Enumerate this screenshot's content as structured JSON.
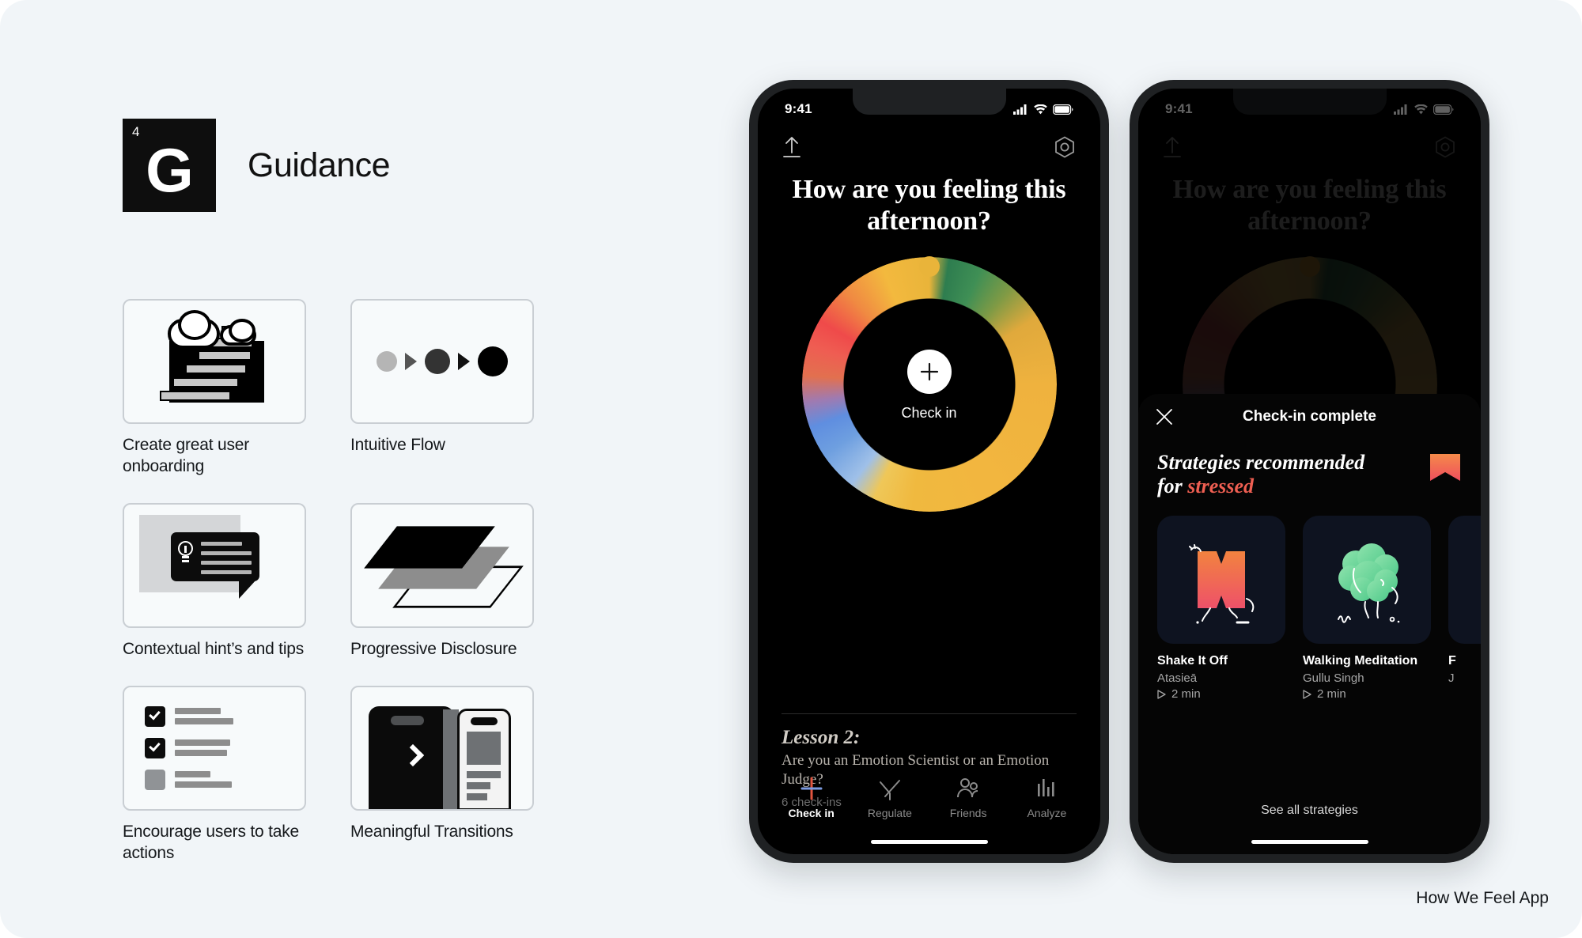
{
  "section": {
    "number": "4",
    "letter": "G",
    "title": "Guidance"
  },
  "principles": [
    {
      "label": "Create great user onboarding",
      "icon": "stairs-clouds-icon"
    },
    {
      "label": "Intuitive Flow",
      "icon": "flow-dots-icon"
    },
    {
      "label": "Contextual hint’s and tips",
      "icon": "hint-bubble-icon"
    },
    {
      "label": "Progressive Disclosure",
      "icon": "stacked-layers-icon"
    },
    {
      "label": "Encourage users to take actions",
      "icon": "checklist-icon"
    },
    {
      "label": "Meaningful Transitions",
      "icon": "screen-transition-icon"
    }
  ],
  "phone_left": {
    "status": {
      "time": "9:41",
      "cellular": "signal-icon",
      "wifi": "wifi-icon",
      "battery": "battery-icon"
    },
    "topbar": {
      "left_icon": "share-upload-icon",
      "right_icon": "hex-settings-icon"
    },
    "heading": "How are you feeling this afternoon?",
    "ring": {
      "plus_icon": "plus-icon",
      "check_in_label": "Check in",
      "cap_color": "#e9b43a",
      "colors": [
        "#e9b43a",
        "#2e7d4f",
        "#7f9a45",
        "#efb23e",
        "#9fc0e8",
        "#5f8ee0",
        "#ef4a4a",
        "#f08a42"
      ]
    },
    "lesson": {
      "title": "Lesson 2:",
      "subtitle": "Are you an Emotion Scientist or an Emotion Judge?",
      "meta": "6 check-ins"
    },
    "tabs": [
      {
        "label": "Check in",
        "icon": "plus-color-icon",
        "active": true
      },
      {
        "label": "Regulate",
        "icon": "breathing-icon",
        "active": false
      },
      {
        "label": "Friends",
        "icon": "friends-icon",
        "active": false
      },
      {
        "label": "Analyze",
        "icon": "bars-icon",
        "active": false
      }
    ]
  },
  "phone_right": {
    "status": {
      "time": "9:41",
      "cellular": "signal-icon",
      "wifi": "wifi-icon",
      "battery": "battery-icon"
    },
    "topbar": {
      "left_icon": "share-upload-icon",
      "right_icon": "hex-settings-icon"
    },
    "heading": "How are you feeling this afternoon?",
    "sheet": {
      "close_icon": "close-x-icon",
      "title": "Check-in complete",
      "headline_prefix": "Strategies recommended for ",
      "headline_emphasis": "stressed",
      "emphasis_color": "#ef5f52",
      "bookmark_icon": "bookmark-chevron-icon",
      "cards": [
        {
          "title": "Shake It Off",
          "author": "Atasieā",
          "duration": "2 min",
          "play_icon": "play-triangle-icon",
          "art": "orange-x-character"
        },
        {
          "title": "Walking Meditation",
          "author": "Gullu Singh",
          "duration": "2 min",
          "play_icon": "play-triangle-icon",
          "art": "green-tree-character"
        },
        {
          "title": "F",
          "author": "J",
          "duration": "",
          "play_icon": "play-triangle-icon",
          "art": "cut-off-card"
        }
      ],
      "see_all_label": "See all strategies"
    }
  },
  "footnote": "How We Feel App"
}
